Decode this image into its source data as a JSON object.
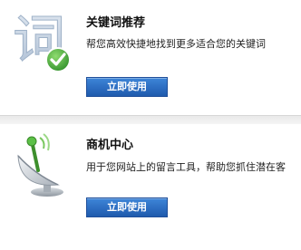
{
  "cards": [
    {
      "title": "关键词推荐",
      "description": "帮您高效快捷地找到更多适合您的关键词",
      "button_label": "立即使用",
      "icon_glyph": "词",
      "icon": "word-badge-check-icon"
    },
    {
      "title": "商机中心",
      "description": "用于您网站上的留言工具，帮助您抓住潜在客",
      "button_label": "立即使用",
      "icon": "satellite-dish-icon"
    }
  ],
  "colors": {
    "button_bg": "#2e6fc3",
    "button_border": "#1f4f9a",
    "check_green": "#3fa83a",
    "dish_grey": "#c9ced4",
    "antenna_green": "#4fae3a"
  }
}
